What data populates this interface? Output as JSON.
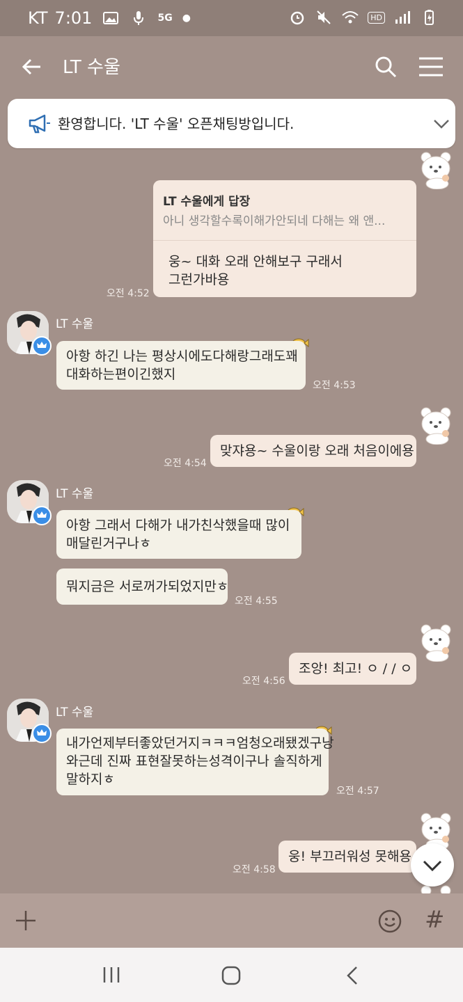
{
  "status_bar": {
    "carrier": "KT",
    "time": "7:01",
    "network": "5G",
    "hd": "HD"
  },
  "header": {
    "title": "LT 수울"
  },
  "notice": {
    "text": "환영합니다. 'LT 수울' 오픈채팅방입니다."
  },
  "messages": {
    "reply": {
      "reply_to": "LT 수울에게 답장",
      "quote": "아니 생각할수록이해가안되네 다해는 왜 앤...",
      "line1": "웅~ 대화 오래 안해보구 구래서",
      "line2": "그런가바용",
      "time": "오전 4:52"
    },
    "m1": {
      "sender": "LT 수울",
      "line1": "아항 하긴 나는 평상시에도다해랑그래도꽤",
      "line2": "대화하는편이긴했지",
      "time": "오전 4:53"
    },
    "m2": {
      "text": "맞쟈용~ 수울이랑 오래  처음이에용",
      "time": "오전 4:54"
    },
    "m3": {
      "sender": "LT 수울",
      "line1": "아항 그래서 다해가 내가친삭했을때 많이",
      "line2": "매달린거구나ㅎ",
      "text2": "뭐지금은 서로꺼가되었지만ㅎ",
      "time": "오전 4:55"
    },
    "m4": {
      "text": "조앙!  최고! ㅇ / / ㅇ",
      "time": "오전 4:56"
    },
    "m5": {
      "sender": "LT 수울",
      "line1": "내가언제부터좋았던거지ㅋㅋㅋ엄청오래됐겠구낭",
      "line2": "와근데 진짜 표현잘못하는성격이구나 솔직하게",
      "line3": "말하지ㅎ",
      "time": "오전 4:57"
    },
    "m6": {
      "text": "웅!  부끄러워성 못해용",
      "time": "오전 4:58"
    }
  },
  "input_bar": {
    "hash": "#"
  },
  "colors": {
    "background": "#a3918a",
    "my_bubble": "#f6e9e0",
    "other_bubble": "#f4f1e7",
    "crown_badge": "#3a8ee6"
  }
}
